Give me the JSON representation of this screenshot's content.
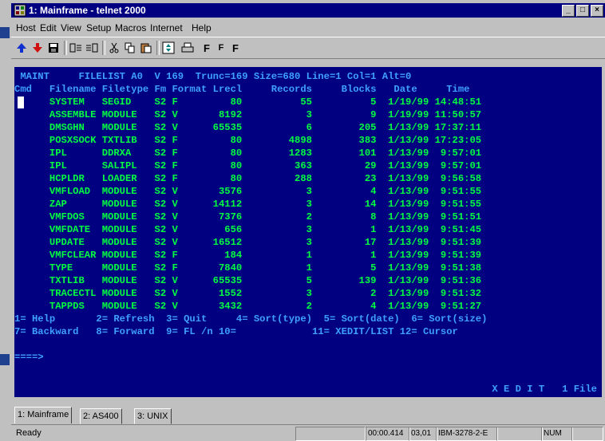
{
  "window": {
    "title": "1: Mainframe - telnet 2000"
  },
  "menu": [
    "Host",
    "Edit",
    "View",
    "Setup",
    "Macros",
    "Internet",
    "Help"
  ],
  "toolbar": {
    "f_buttons": [
      "F",
      "F",
      "F"
    ]
  },
  "terminal": {
    "header": " MAINT     FILELIST A0  V 169  Trunc=169 Size=680 Line=1 Col=1 Alt=0",
    "columns": "Cmd   Filename Filetype Fm Format Lrecl     Records     Blocks   Date     Time",
    "rows": [
      "      SYSTEM   SEGID    S2 F         80          55          5  1/19/99 14:48:51",
      "      ASSEMBLE MODULE   S2 V       8192           3          9  1/19/99 11:50:57",
      "      DMSGHN   MODULE   S2 V      65535           6        205  1/13/99 17:37:11",
      "      POSXSOCK TXTLIB   S2 F         80        4898        383  1/13/99 17:23:05",
      "      IPL      DDRXA    S2 F         80        1283        101  1/13/99  9:57:01",
      "      IPL      SALIPL   S2 F         80         363         29  1/13/99  9:57:01",
      "      HCPLDR   LOADER   S2 F         80         288         23  1/13/99  9:56:58",
      "      VMFLOAD  MODULE   S2 V       3576           3          4  1/13/99  9:51:55",
      "      ZAP      MODULE   S2 V      14112           3         14  1/13/99  9:51:55",
      "      VMFDOS   MODULE   S2 V       7376           2          8  1/13/99  9:51:51",
      "      VMFDATE  MODULE   S2 V        656           3          1  1/13/99  9:51:45",
      "      UPDATE   MODULE   S2 V      16512           3         17  1/13/99  9:51:39",
      "      VMFCLEAR MODULE   S2 F        184           1          1  1/13/99  9:51:39",
      "      TYPE     MODULE   S2 F       7840           1          5  1/13/99  9:51:38",
      "      TXTLIB   MODULE   S2 V      65535           5        139  1/13/99  9:51:36",
      "      TRACECTL MODULE   S2 V       1552           3          2  1/13/99  9:51:32",
      "      TAPPDS   MODULE   S2 V       3432           2          4  1/13/99  9:51:27"
    ],
    "pf1": "1= Help       2= Refresh  3= Quit     4= Sort(type)  5= Sort(date)  6= Sort(size)",
    "pf2": "7= Backward   8= Forward  9= FL /n 10=             11= XEDIT/LIST 12= Cursor",
    "command_line": "====>",
    "status": "X E D I T   1 File"
  },
  "tabs": [
    "1: Mainframe",
    "2: AS400",
    "3: UNIX"
  ],
  "status_bar": {
    "ready": "Ready",
    "elapsed": "00:00.414",
    "cursor_pos": "03,01",
    "terminal_type": "IBM-3278-2-E",
    "num": "NUM"
  }
}
